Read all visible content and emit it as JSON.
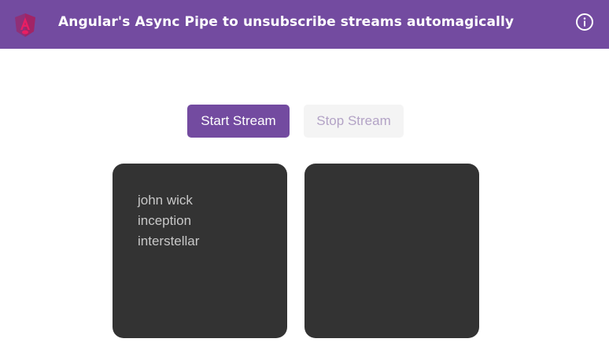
{
  "header": {
    "title": "Angular's Async Pipe to unsubscribe streams automagically",
    "logo_icon": "angular-logo-icon",
    "info_icon": "info-icon",
    "background": "#734ba0"
  },
  "controls": {
    "start_label": "Start Stream",
    "stop_label": "Stop Stream"
  },
  "panels": {
    "left": {
      "items": [
        "john wick",
        "inception",
        "interstellar"
      ]
    },
    "right": {
      "items": []
    }
  },
  "colors": {
    "accent": "#734ba0",
    "panel": "#333333",
    "list_text": "#c8c8c8",
    "disabled_text": "#b3a3c6"
  }
}
